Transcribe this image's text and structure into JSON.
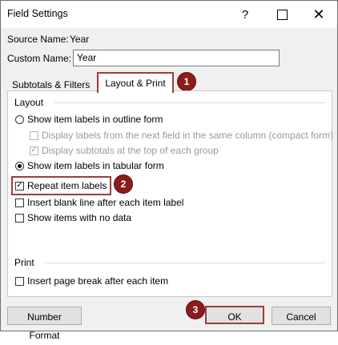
{
  "window": {
    "title": "Field Settings"
  },
  "titlebar_icons": {
    "help": "help-icon",
    "maximize": "maximize-icon",
    "close": "close-icon"
  },
  "fields": {
    "source_name_label": "Source Name:",
    "source_name_value": "Year",
    "custom_name_label": "Custom Name:",
    "custom_name_value": "Year"
  },
  "tabs": [
    {
      "label": "Subtotals & Filters",
      "selected": false
    },
    {
      "label": "Layout & Print",
      "selected": true
    }
  ],
  "layout": {
    "section_title": "Layout",
    "options": {
      "outline_form": "Show item labels in outline form",
      "compact_form": "Display labels from the next field in the same column (compact form)",
      "subtotals_top": "Display subtotals at the top of each group",
      "tabular_form": "Show item labels in tabular form",
      "repeat_labels": "Repeat item labels",
      "insert_blank": "Insert blank line after each item label",
      "show_no_data": "Show items with no data"
    },
    "state": {
      "outline_form": false,
      "compact_form": false,
      "subtotals_top": true,
      "tabular_form": true,
      "repeat_labels": true,
      "insert_blank": false,
      "show_no_data": false
    }
  },
  "print": {
    "section_title": "Print",
    "page_break": "Insert page break after each item",
    "page_break_checked": false
  },
  "buttons": {
    "number_format": "Number Format",
    "ok": "OK",
    "cancel": "Cancel"
  },
  "badges": [
    "1",
    "2",
    "3"
  ],
  "colors": {
    "highlight": "#a23b3b",
    "badge": "#8b1c1c"
  }
}
